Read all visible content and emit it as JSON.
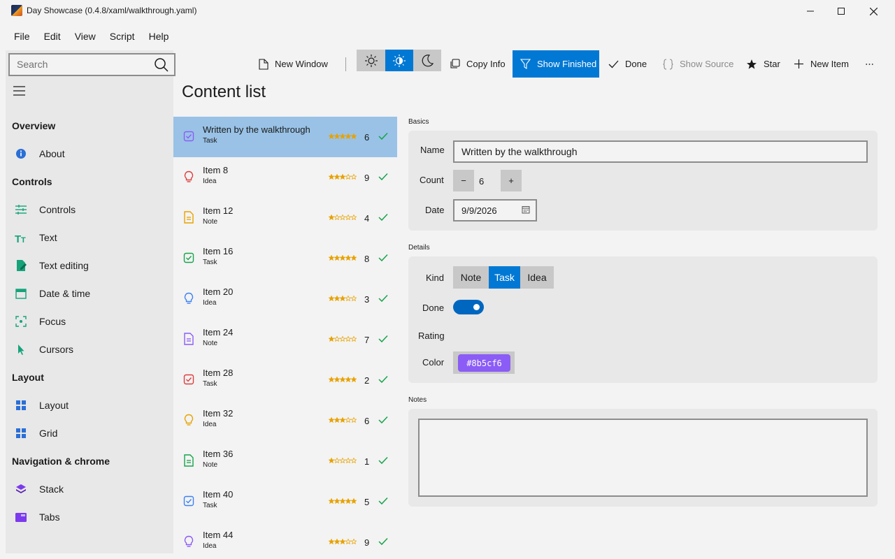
{
  "window": {
    "title": "Day Showcase (0.4.8/xaml/walkthrough.yaml)"
  },
  "menu": [
    "File",
    "Edit",
    "View",
    "Script",
    "Help"
  ],
  "search": {
    "placeholder": "Search"
  },
  "nav": {
    "groups": [
      {
        "label": "Overview",
        "items": [
          {
            "label": "About",
            "icon": "info-icon"
          }
        ]
      },
      {
        "label": "Controls",
        "items": [
          {
            "label": "Controls",
            "icon": "sliders-icon"
          },
          {
            "label": "Text",
            "icon": "text-size-icon"
          },
          {
            "label": "Text editing",
            "icon": "edit-document-icon"
          },
          {
            "label": "Date & time",
            "icon": "calendar-icon"
          },
          {
            "label": "Focus",
            "icon": "focus-icon"
          },
          {
            "label": "Cursors",
            "icon": "cursor-icon"
          }
        ]
      },
      {
        "label": "Layout",
        "items": [
          {
            "label": "Layout",
            "icon": "layout-grid-icon"
          },
          {
            "label": "Grid",
            "icon": "grid-icon"
          }
        ]
      },
      {
        "label": "Navigation & chrome",
        "items": [
          {
            "label": "Stack",
            "icon": "stack-icon"
          },
          {
            "label": "Tabs",
            "icon": "tabs-icon"
          }
        ]
      }
    ]
  },
  "toolbar": {
    "new_window": "New Window",
    "copy_info": "Copy Info",
    "show_finished": "Show Finished",
    "done": "Done",
    "show_source": "Show Source",
    "star": "Star",
    "new_item": "New Item",
    "theme_selected": "auto"
  },
  "content": {
    "title": "Content list",
    "items": [
      {
        "title": "Written by the walkthrough",
        "kind": "Task",
        "count": "6",
        "rating": 5,
        "selected": true,
        "color": "#8b5cf6"
      },
      {
        "title": "Item 8",
        "kind": "Idea",
        "count": "9",
        "rating": 3,
        "color": "#e03c3c"
      },
      {
        "title": "Item 12",
        "kind": "Note",
        "count": "4",
        "rating": 1,
        "color": "#e8a200"
      },
      {
        "title": "Item 16",
        "kind": "Task",
        "count": "8",
        "rating": 5,
        "color": "#16a34a"
      },
      {
        "title": "Item 20",
        "kind": "Idea",
        "count": "3",
        "rating": 3,
        "color": "#3b82f6"
      },
      {
        "title": "Item 24",
        "kind": "Note",
        "count": "7",
        "rating": 1,
        "color": "#8b5cf6"
      },
      {
        "title": "Item 28",
        "kind": "Task",
        "count": "2",
        "rating": 5,
        "color": "#e03c3c"
      },
      {
        "title": "Item 32",
        "kind": "Idea",
        "count": "6",
        "rating": 3,
        "color": "#e8a200"
      },
      {
        "title": "Item 36",
        "kind": "Note",
        "count": "1",
        "rating": 1,
        "color": "#16a34a"
      },
      {
        "title": "Item 40",
        "kind": "Task",
        "count": "5",
        "rating": 5,
        "color": "#3b82f6"
      },
      {
        "title": "Item 44",
        "kind": "Idea",
        "count": "9",
        "rating": 3,
        "color": "#8b5cf6"
      }
    ]
  },
  "detail": {
    "basics_label": "Basics",
    "name_label": "Name",
    "name_value": "Written by the walkthrough",
    "count_label": "Count",
    "count_value": "6",
    "decrement": "−",
    "increment": "+",
    "date_label": "Date",
    "date_value": "9/9/2026",
    "details_label": "Details",
    "kind_label": "Kind",
    "kind_options": [
      "Note",
      "Task",
      "Idea"
    ],
    "kind_selected": "Task",
    "done_label": "Done",
    "done_value": true,
    "rating_label": "Rating",
    "color_label": "Color",
    "color_value": "#8b5cf6",
    "color_text": "#8b5cf6",
    "notes_label": "Notes",
    "notes_value": ""
  },
  "colors": {
    "accent": "#0078d4",
    "selection": "#99c2e6",
    "check": "#16a34a",
    "star": "#e8a200"
  }
}
